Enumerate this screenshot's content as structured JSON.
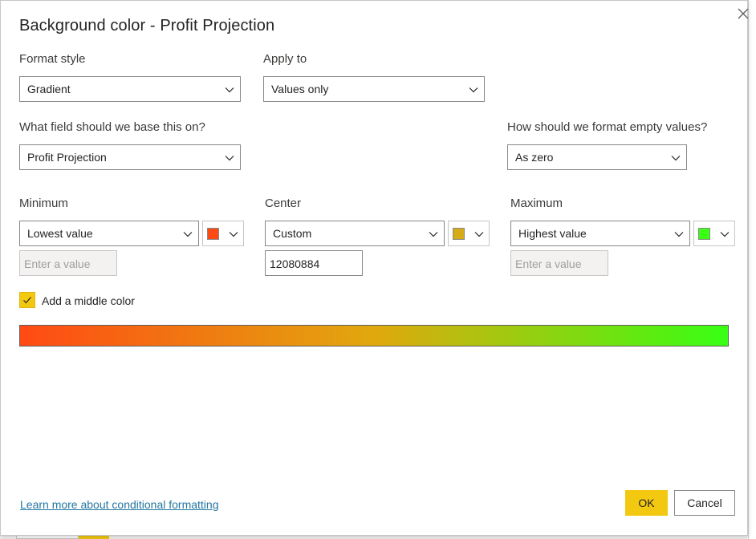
{
  "dialog": {
    "title": "Background color - Profit Projection",
    "close_icon": "close-icon"
  },
  "format_style": {
    "label": "Format style",
    "value": "Gradient"
  },
  "apply_to": {
    "label": "Apply to",
    "value": "Values only"
  },
  "base_field": {
    "label": "What field should we base this on?",
    "value": "Profit Projection"
  },
  "empty_values": {
    "label": "How should we format empty values?",
    "value": "As zero"
  },
  "minimum": {
    "label": "Minimum",
    "type": "Lowest value",
    "color": "#ff4a14",
    "input_placeholder": "Enter a value"
  },
  "center": {
    "label": "Center",
    "type": "Custom",
    "color": "#d6ab18",
    "input_value": "12080884"
  },
  "maximum": {
    "label": "Maximum",
    "type": "Highest value",
    "color": "#38ff14",
    "input_placeholder": "Enter a value"
  },
  "middle_color": {
    "label": "Add a middle color",
    "checked": true
  },
  "footer": {
    "link": "Learn more about conditional formatting",
    "ok": "OK",
    "cancel": "Cancel"
  }
}
